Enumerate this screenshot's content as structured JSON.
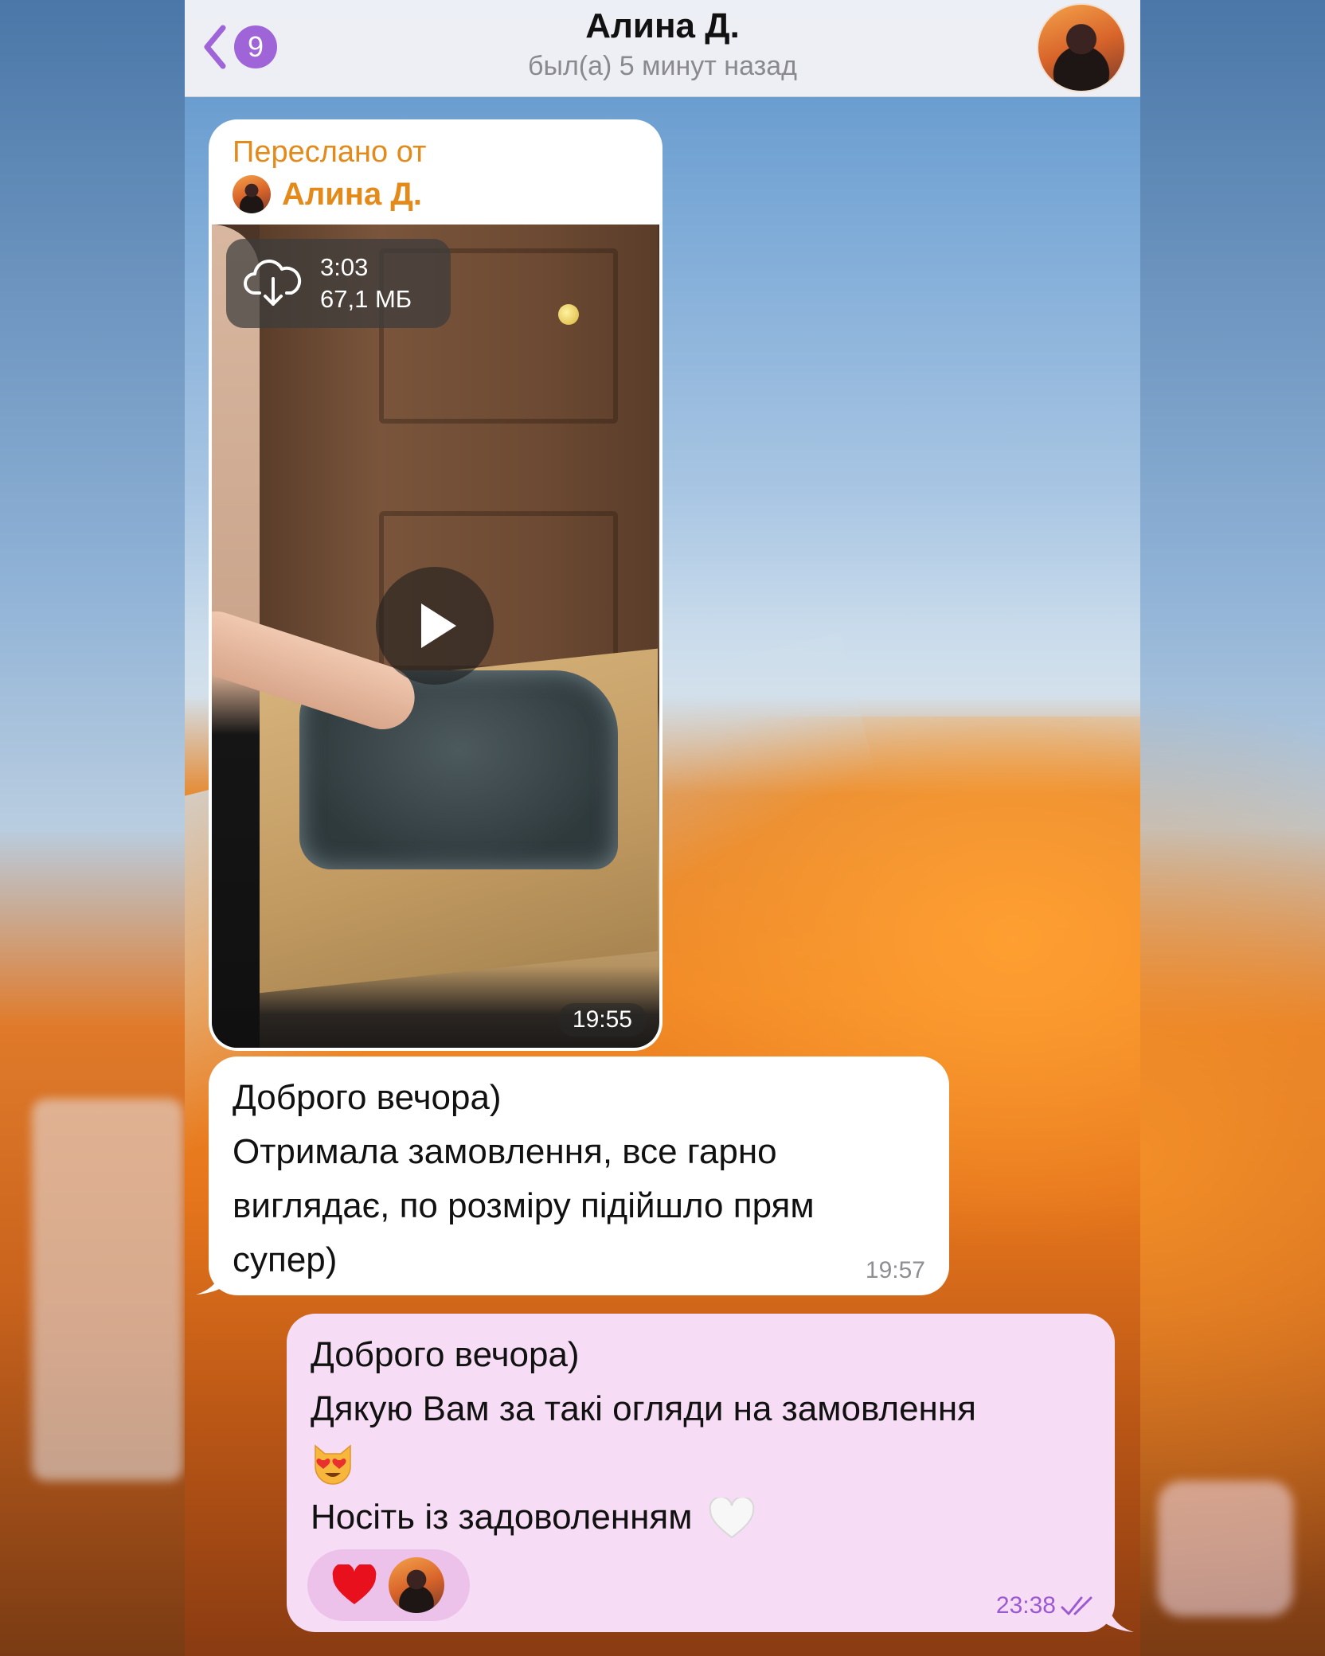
{
  "header": {
    "back_badge": "9",
    "title": "Алина Д.",
    "subtitle": "был(а) 5 минут назад"
  },
  "messages": {
    "forwarded": {
      "label": "Переслано от",
      "author": "Алина Д.",
      "video_duration": "3:03",
      "video_size": "67,1 МБ",
      "time": "19:55"
    },
    "incoming": {
      "text": "Доброго вечора)\nОтримала замовлення, все гарно\nвиглядає, по розміру підійшло прям\nсупер)",
      "time": "19:57"
    },
    "outgoing": {
      "line1": "Доброго вечора)",
      "line2": "Дякую Вам за такі огляди на замовлення",
      "line4": "Носіть із задоволенням",
      "time": "23:38",
      "reaction": "heart-icon"
    }
  },
  "colors": {
    "accent": "#a064d9",
    "forward_orange": "#e48a1a",
    "outgoing_bubble": "#f6dcf4",
    "incoming_bubble": "#ffffff"
  }
}
